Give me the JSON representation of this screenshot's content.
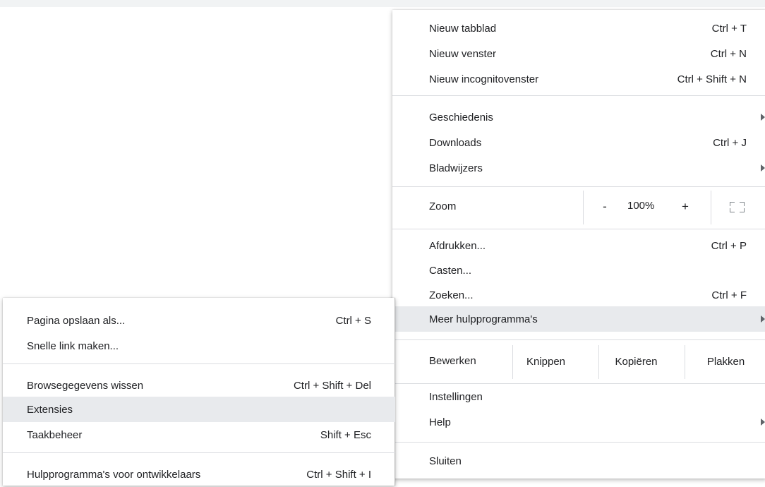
{
  "main_menu": {
    "new_tab": {
      "label": "Nieuw tabblad",
      "shortcut": "Ctrl + T"
    },
    "new_window": {
      "label": "Nieuw venster",
      "shortcut": "Ctrl + N"
    },
    "new_incognito": {
      "label": "Nieuw incognitovenster",
      "shortcut": "Ctrl + Shift + N"
    },
    "history": {
      "label": "Geschiedenis"
    },
    "downloads": {
      "label": "Downloads",
      "shortcut": "Ctrl + J"
    },
    "bookmarks": {
      "label": "Bladwijzers"
    },
    "zoom": {
      "label": "Zoom",
      "minus": "-",
      "value": "100%",
      "plus": "+"
    },
    "print": {
      "label": "Afdrukken...",
      "shortcut": "Ctrl + P"
    },
    "cast": {
      "label": "Casten..."
    },
    "find": {
      "label": "Zoeken...",
      "shortcut": "Ctrl + F"
    },
    "more_tools": {
      "label": "Meer hulpprogramma's"
    },
    "edit": {
      "label": "Bewerken",
      "cut": "Knippen",
      "copy": "Kopiëren",
      "paste": "Plakken"
    },
    "settings": {
      "label": "Instellingen"
    },
    "help": {
      "label": "Help"
    },
    "exit": {
      "label": "Sluiten"
    }
  },
  "sub_menu": {
    "save_page": {
      "label": "Pagina opslaan als...",
      "shortcut": "Ctrl + S"
    },
    "create_shortcut": {
      "label": "Snelle link maken..."
    },
    "clear_data": {
      "label": "Browsegegevens wissen",
      "shortcut": "Ctrl + Shift + Del"
    },
    "extensions": {
      "label": "Extensies"
    },
    "task_manager": {
      "label": "Taakbeheer",
      "shortcut": "Shift + Esc"
    },
    "dev_tools": {
      "label": "Hulpprogramma's voor ontwikkelaars",
      "shortcut": "Ctrl + Shift + I"
    }
  },
  "colors": {
    "highlight": "#e8eaed",
    "separator": "#dadce0",
    "text": "#202124"
  }
}
